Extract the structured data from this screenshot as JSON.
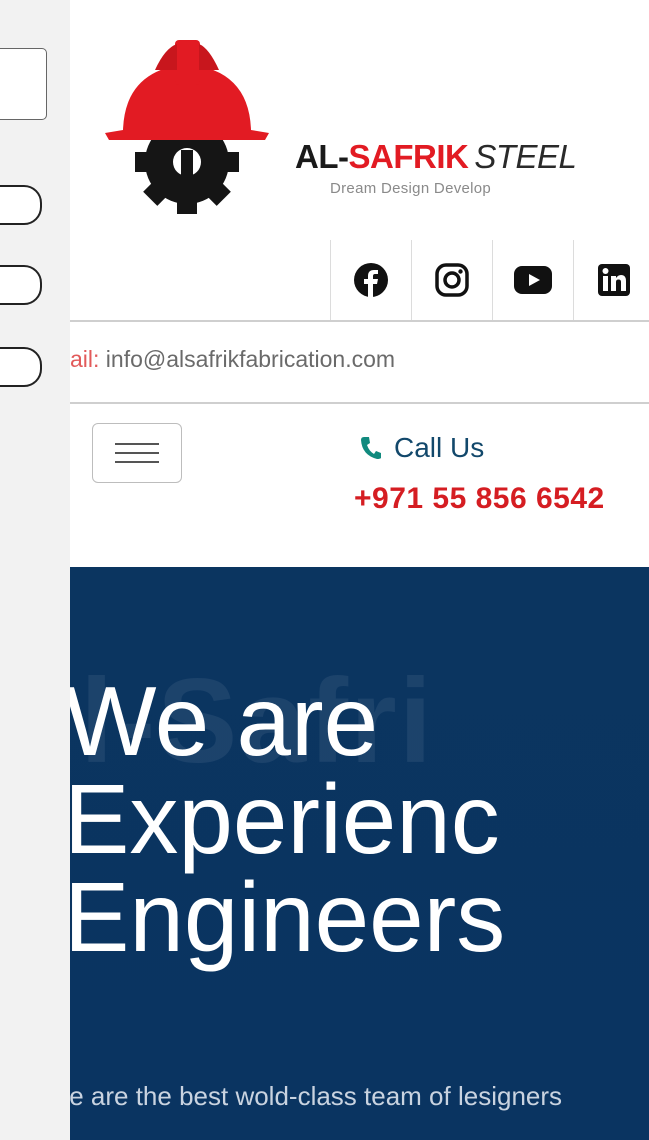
{
  "brand": {
    "prefix": "AL-",
    "name": "SAFRIK",
    "suffix": "STEEL",
    "tagline": "Dream Design Develop",
    "logo_icon": "helmet-gear-icon",
    "colors": {
      "red": "#e21b23",
      "dark": "#1a1a1a"
    }
  },
  "social": [
    {
      "icon": "facebook-icon"
    },
    {
      "icon": "instagram-icon"
    },
    {
      "icon": "youtube-icon"
    },
    {
      "icon": "linkedin-icon"
    }
  ],
  "contact": {
    "email_label": "ail:",
    "email": "info@alsafrikfabrication.com",
    "call_label": "Call Us",
    "phone": "+971 55 856 6542"
  },
  "hero": {
    "background_text": "l-Safri",
    "title": "We are\nExperienc\nEngineers",
    "subtitle": "/e are the best wold-class team of lesigners",
    "background_color": "#0b3560"
  }
}
